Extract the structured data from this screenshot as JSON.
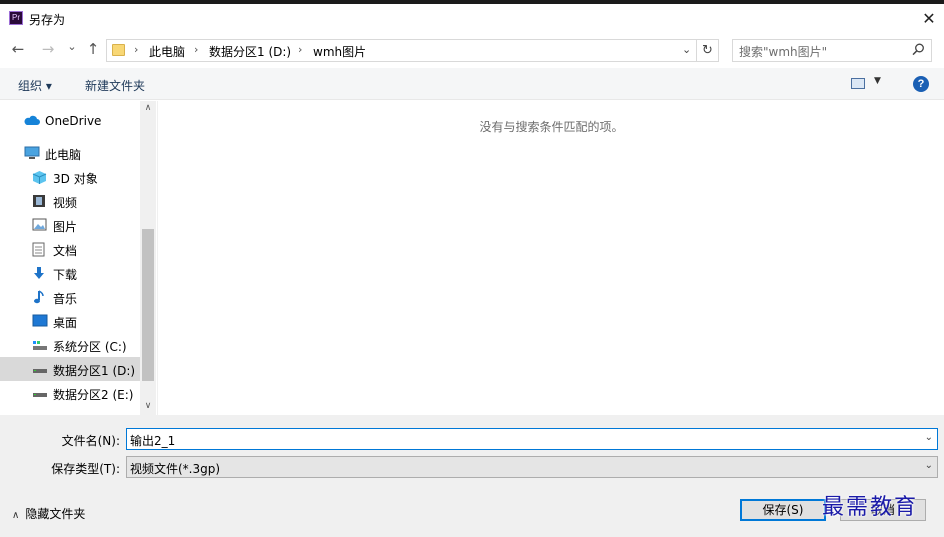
{
  "window": {
    "app_icon_text": "Pr",
    "title": "另存为",
    "close_symbol": "✕"
  },
  "address": {
    "back_symbol": "←",
    "forward_symbol": "→",
    "recent_symbol": "⌄",
    "up_symbol": "↑",
    "breadcrumbs": [
      "此电脑",
      "数据分区1 (D:)",
      "wmh图片"
    ],
    "separator": "›",
    "dropdown_symbol": "⌄",
    "refresh_symbol": "↻"
  },
  "search": {
    "placeholder": "搜索\"wmh图片\"",
    "icon": "search-icon"
  },
  "toolbar": {
    "organize_label": "组织 ▾",
    "new_folder_label": "新建文件夹",
    "help_label": "?"
  },
  "sidebar": {
    "items": [
      {
        "label": "OneDrive",
        "icon": "cloud-icon",
        "indent": 0,
        "selected": false
      },
      {
        "label": "此电脑",
        "icon": "computer-icon",
        "indent": 0,
        "selected": false
      },
      {
        "label": "3D 对象",
        "icon": "cube-icon",
        "indent": 1,
        "selected": false
      },
      {
        "label": "视频",
        "icon": "film-icon",
        "indent": 1,
        "selected": false
      },
      {
        "label": "图片",
        "icon": "picture-icon",
        "indent": 1,
        "selected": false
      },
      {
        "label": "文档",
        "icon": "document-icon",
        "indent": 1,
        "selected": false
      },
      {
        "label": "下载",
        "icon": "download-icon",
        "indent": 1,
        "selected": false
      },
      {
        "label": "音乐",
        "icon": "music-icon",
        "indent": 1,
        "selected": false
      },
      {
        "label": "桌面",
        "icon": "desktop-icon",
        "indent": 1,
        "selected": false
      },
      {
        "label": "系统分区 (C:)",
        "icon": "drive-icon",
        "indent": 1,
        "selected": false
      },
      {
        "label": "数据分区1 (D:)",
        "icon": "drive-icon",
        "indent": 1,
        "selected": true
      },
      {
        "label": "数据分区2 (E:)",
        "icon": "drive-icon",
        "indent": 1,
        "selected": false
      }
    ],
    "scroll_up_symbol": "∧",
    "scroll_down_symbol": "∨"
  },
  "content": {
    "empty_message": "没有与搜索条件匹配的项。"
  },
  "form": {
    "filename_label": "文件名(N):",
    "filename_value": "输出2_1",
    "filetype_label": "保存类型(T):",
    "filetype_value": "视频文件(*.3gp)",
    "dropdown_symbol": "⌄"
  },
  "footer": {
    "hide_folders_label": "隐藏文件夹",
    "hide_folders_chevron": "∧",
    "save_label": "保存(S)",
    "cancel_label": "取消"
  },
  "watermark": {
    "text": "最需教育"
  },
  "colors": {
    "accent": "#0078d7",
    "selected_row": "#d9d9d9",
    "bottom_panel": "#f0f0f0",
    "toolbar": "#f5f6f7",
    "watermark": "#1a1aa8"
  }
}
